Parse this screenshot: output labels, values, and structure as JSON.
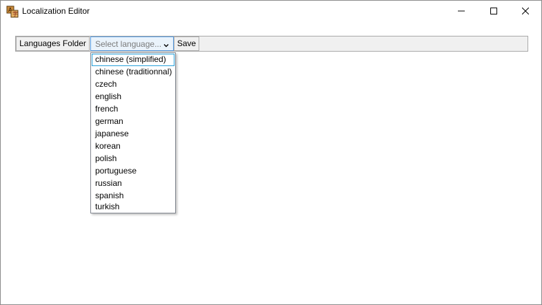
{
  "window": {
    "title": "Localization Editor",
    "app_icon": "localization-app-icon",
    "caption_buttons": [
      "minimize-icon",
      "maximize-icon",
      "close-icon"
    ]
  },
  "toolbar": {
    "languages_folder_label": "Languages Folder",
    "language_select_placeholder": "Select language...",
    "save_label": "Save"
  },
  "dropdown": {
    "highlighted_item": "chinese (simplified)",
    "items": [
      "chinese (simplified)",
      "chinese (traditionnal)",
      "czech",
      "english",
      "french",
      "german",
      "japanese",
      "korean",
      "polish",
      "portuguese",
      "russian",
      "spanish",
      "turkish"
    ]
  },
  "colors": {
    "combo_border": "#569de5",
    "combo_background": "#eaf3fb",
    "selection_border": "#26a0da",
    "toolbar_background": "#f0f0f0"
  }
}
